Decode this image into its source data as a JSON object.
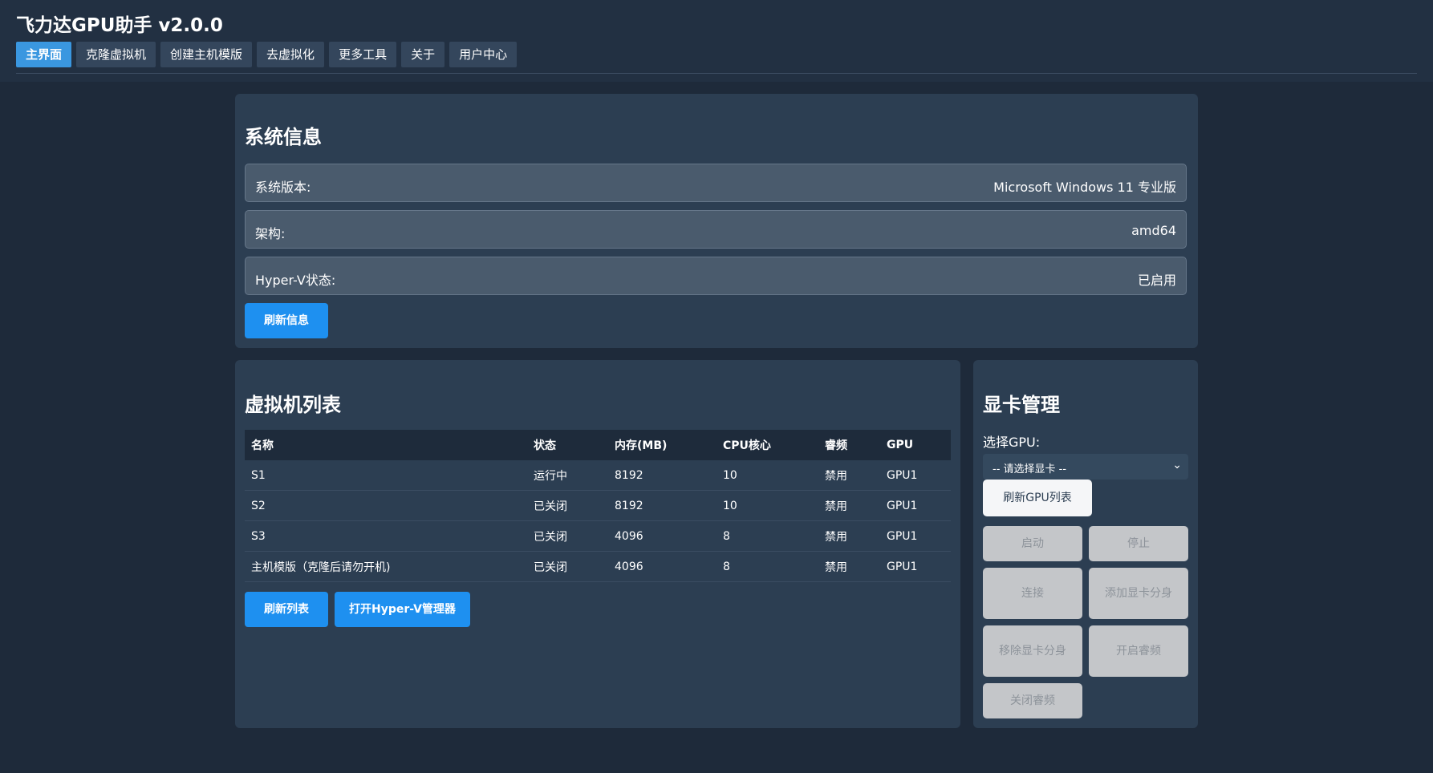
{
  "app": {
    "title": "飞力达GPU助手 v2.0.0"
  },
  "tabs": [
    {
      "label": "主界面",
      "active": true
    },
    {
      "label": "克隆虚拟机"
    },
    {
      "label": "创建主机模版"
    },
    {
      "label": "去虚拟化"
    },
    {
      "label": "更多工具"
    },
    {
      "label": "关于"
    },
    {
      "label": "用户中心"
    }
  ],
  "system_info": {
    "title": "系统信息",
    "rows": [
      {
        "label": "系统版本:",
        "value": "Microsoft Windows 11 专业版"
      },
      {
        "label": "架构:",
        "value": "amd64"
      },
      {
        "label": "Hyper-V状态:",
        "value": "已启用"
      }
    ],
    "refresh_button": "刷新信息"
  },
  "vm_list": {
    "title": "虚拟机列表",
    "columns": [
      "名称",
      "状态",
      "内存(MB)",
      "CPU核心",
      "睿频",
      "GPU"
    ],
    "rows": [
      [
        "S1",
        "运行中",
        "8192",
        "10",
        "禁用",
        "GPU1"
      ],
      [
        "S2",
        "已关闭",
        "8192",
        "10",
        "禁用",
        "GPU1"
      ],
      [
        "S3",
        "已关闭",
        "4096",
        "8",
        "禁用",
        "GPU1"
      ],
      [
        "主机模版（克隆后请勿开机)",
        "已关闭",
        "4096",
        "8",
        "禁用",
        "GPU1"
      ]
    ],
    "refresh_button": "刷新列表",
    "open_hyperv_button": "打开Hyper-V管理器"
  },
  "gpu_manage": {
    "title": "显卡管理",
    "select_label": "选择GPU:",
    "select_value": "-- 请选择显卡 --",
    "refresh_button": "刷新GPU列表",
    "buttons": {
      "start": "启动",
      "stop": "停止",
      "connect": "连接",
      "add_partition": "添加显卡分身",
      "remove_partition": "移除显卡分身",
      "enable_turbo": "开启睿频",
      "disable_turbo": "关闭睿频"
    }
  },
  "colors": {
    "background": "#1e2a3a",
    "panel": "#2c3e52",
    "accent": "#1e90f0",
    "active_tab": "#3a97e0",
    "disabled_button": "#c4c6c9"
  }
}
